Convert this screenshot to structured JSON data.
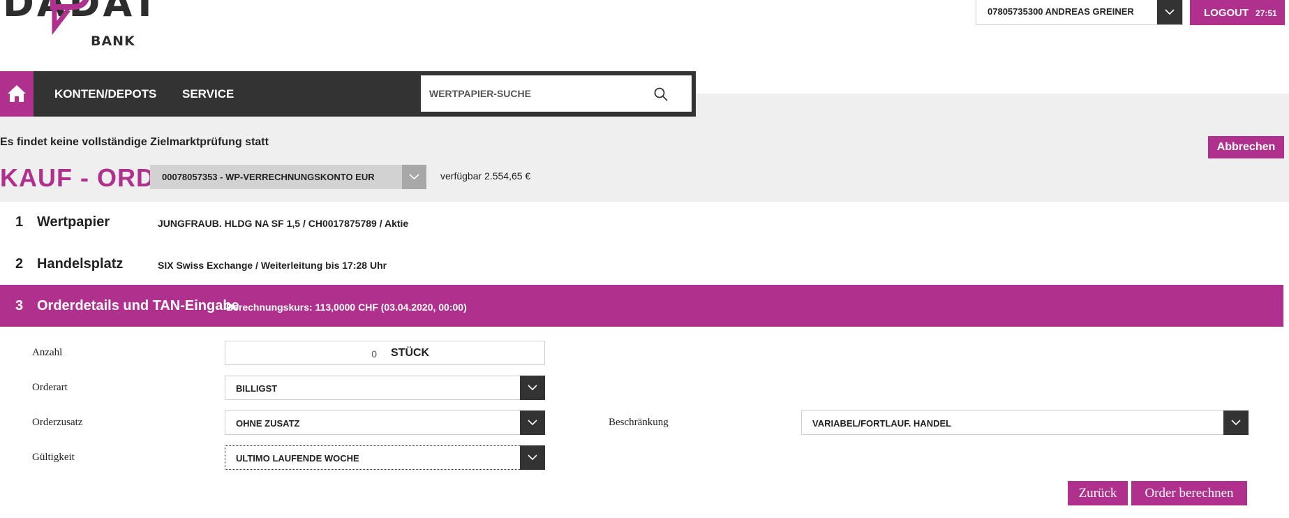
{
  "logo": {
    "wordmark": "DADAT",
    "sub": "BANK"
  },
  "account": {
    "selected": "07805735300 ANDREAS GREINER"
  },
  "logout": {
    "label": "LOGOUT",
    "timer": "27:51"
  },
  "nav": {
    "items": [
      "KONTEN/DEPOTS",
      "SERVICE"
    ],
    "search_placeholder": "WERTPAPIER-SUCHE"
  },
  "notice": "Es findet keine vollständige Zielmarktprüfung statt",
  "cancel_label": "Abbrechen",
  "order": {
    "title": "KAUF - ORDER",
    "konto": "00078057353 - WP-VERRECHNUNGSKONTO EUR",
    "available": "verfügbar 2.554,65 €"
  },
  "steps": [
    {
      "num": "1",
      "title": "Wertpapier",
      "info": "JUNGFRAUB. HLDG NA SF 1,5 / CH0017875789 / Aktie"
    },
    {
      "num": "2",
      "title": "Handelsplatz",
      "info": "SIX Swiss Exchange / Weiterleitung bis 17:28 Uhr"
    },
    {
      "num": "3",
      "title": "Orderdetails und TAN-Eingabe",
      "info": "Berechnungskurs: 113,0000 CHF (03.04.2020, 00:00)"
    }
  ],
  "form": {
    "anzahl": {
      "label": "Anzahl",
      "value": "0",
      "unit": "STÜCK"
    },
    "orderart": {
      "label": "Orderart",
      "value": "BILLIGST"
    },
    "orderzusatz": {
      "label": "Orderzusatz",
      "value": "OHNE ZUSATZ"
    },
    "gueltigkeit": {
      "label": "Gültigkeit",
      "value": "ULTIMO LAUFENDE WOCHE"
    },
    "beschraenkung": {
      "label": "Beschränkung",
      "value": "VARIABEL/FORTLAUF. HANDEL"
    }
  },
  "buttons": {
    "back": "Zurück",
    "calc": "Order berechnen"
  },
  "colors": {
    "accent": "#b0308d",
    "dark": "#333333",
    "band": "#efefef"
  }
}
